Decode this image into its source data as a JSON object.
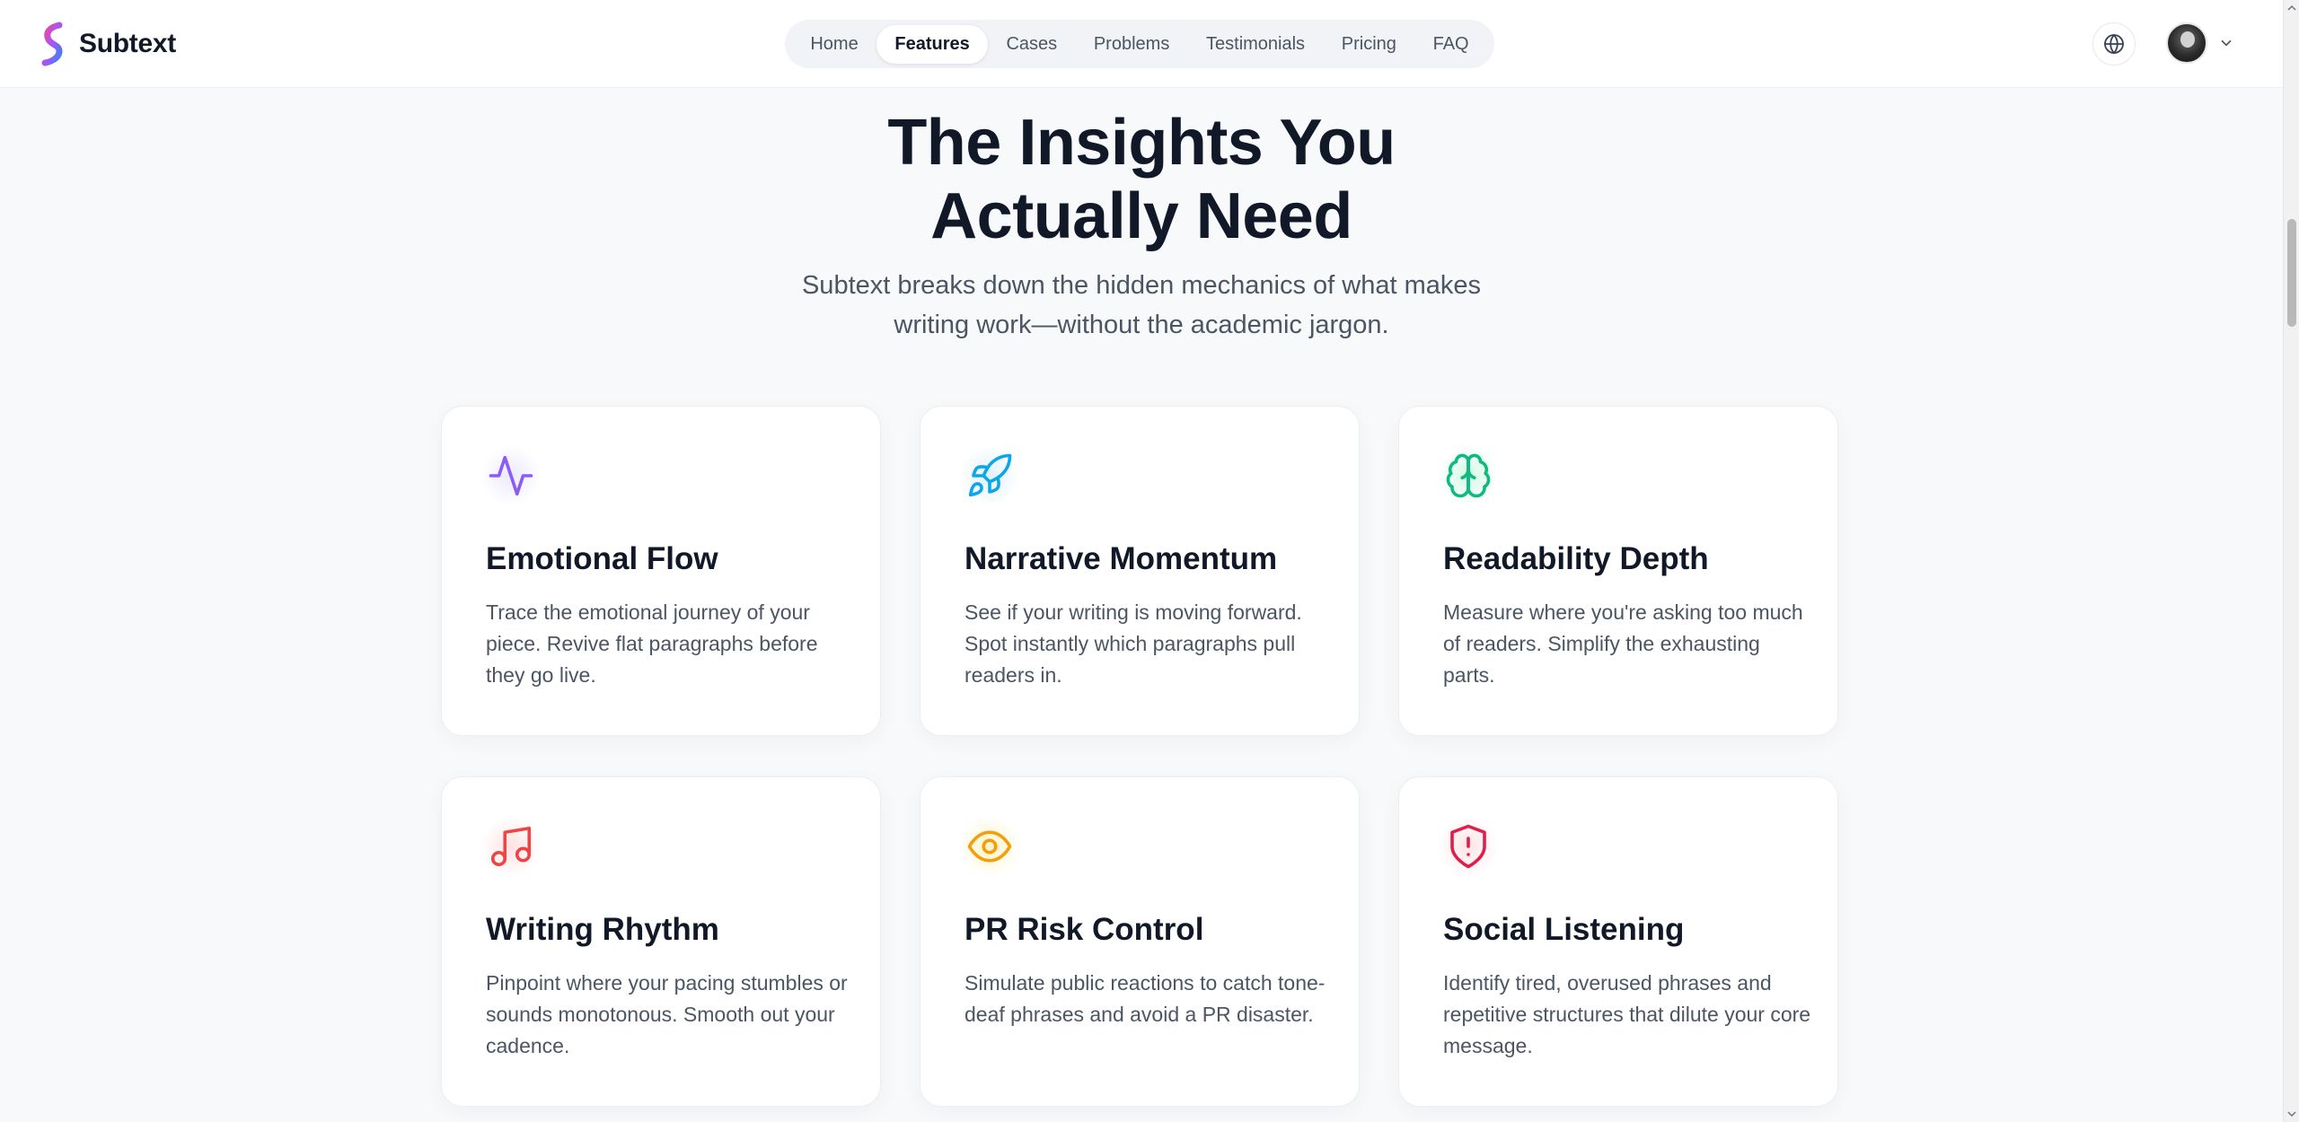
{
  "header": {
    "brand_name": "Subtext",
    "nav": [
      {
        "label": "Home",
        "active": false
      },
      {
        "label": "Features",
        "active": true
      },
      {
        "label": "Cases",
        "active": false
      },
      {
        "label": "Problems",
        "active": false
      },
      {
        "label": "Testimonials",
        "active": false
      },
      {
        "label": "Pricing",
        "active": false
      },
      {
        "label": "FAQ",
        "active": false
      }
    ],
    "language_icon": "globe-icon",
    "user_menu_icon": "chevron-down-icon"
  },
  "hero": {
    "title_line1": "The Insights You",
    "title_line2": "Actually Need",
    "subtitle_line1": "Subtext breaks down the hidden mechanics of what makes",
    "subtitle_line2": "writing work—without the academic jargon."
  },
  "features": [
    {
      "icon": "activity-icon",
      "color": "#8b5cf6",
      "glow": "#ede9fe",
      "title": "Emotional Flow",
      "desc": "Trace the emotional journey of your piece. Revive flat paragraphs before they go live."
    },
    {
      "icon": "rocket-icon",
      "color": "#0ea5e9",
      "glow": "#e0f2fe",
      "title": "Narrative Momentum",
      "desc": "See if your writing is moving forward. Spot instantly which paragraphs pull readers in."
    },
    {
      "icon": "brain-icon",
      "color": "#10b981",
      "glow": "#d1fae5",
      "title": "Readability Depth",
      "desc": "Measure where you're asking too much of readers. Simplify the exhausting parts."
    },
    {
      "icon": "music-icon",
      "color": "#ef4444",
      "glow": "#fee2e2",
      "title": "Writing Rhythm",
      "desc": "Pinpoint where your pacing stumbles or sounds monotonous. Smooth out your cadence."
    },
    {
      "icon": "eye-icon",
      "color": "#f59e0b",
      "glow": "#fef3c7",
      "title": "PR Risk Control",
      "desc": "Simulate public reactions to catch tone-deaf phrases and avoid a PR disaster."
    },
    {
      "icon": "shield-alert-icon",
      "color": "#e11d48",
      "glow": "#ffe4e6",
      "title": "Social Listening",
      "desc": "Identify tired, overused phrases and repetitive structures that dilute your core message."
    }
  ]
}
